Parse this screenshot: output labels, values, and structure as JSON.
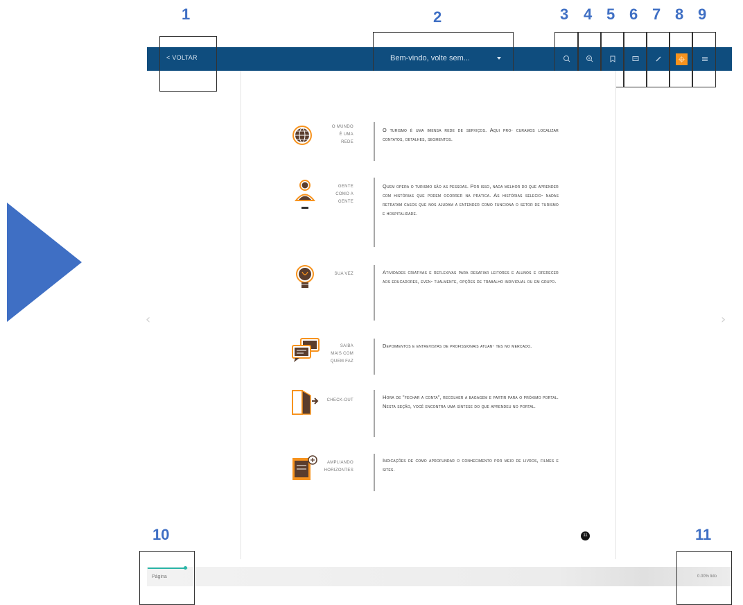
{
  "callouts": [
    "1",
    "2",
    "3",
    "4",
    "5",
    "6",
    "7",
    "8",
    "9",
    "10",
    "11"
  ],
  "toolbar": {
    "back_label": "< VOLTAR",
    "chapter_title": "Bem-vindo, volte sem...",
    "icons": [
      "search-icon",
      "zoom-in-icon",
      "bookmark-icon",
      "comment-icon",
      "pencil-icon",
      "highlight-icon",
      "menu-icon"
    ],
    "accent": "#f7931e",
    "bar_color": "#0f4d7e"
  },
  "content": {
    "rows": [
      {
        "icon": "globe-icon",
        "label": [
          "O MUNDO",
          "É UMA",
          "REDE"
        ],
        "text": "O turismo é uma imensa rede de serviços. Aqui pro- curamos localizar contatos, detalhes, segmentos."
      },
      {
        "icon": "person-icon",
        "label": [
          "GENTE",
          "COMO A",
          "GENTE"
        ],
        "text": "Quem opera o turismo são as pessoas. Por isso, nada melhor do que aprender com histórias que podem ocorrer na prática. As histórias selecio- nadas retratam casos que nos ajudam a entender como funciona o setor de turismo e hospitalidade."
      },
      {
        "icon": "lightbulb-icon",
        "label": [
          "SUA VEZ"
        ],
        "text": "Atividades criativas e reflexivas para desafiar leitores e alunos e oferecer aos educadores, even- tualmente, opções de trabalho individual ou em grupo."
      },
      {
        "icon": "speech-bubbles-icon",
        "label": [
          "SAIBA",
          "MAIS COM",
          "QUEM FAZ"
        ],
        "text": "Depoimentos e entrevistas de profissionais atuan- tes no mercado."
      },
      {
        "icon": "door-exit-icon",
        "label": [
          "CHECK-OUT"
        ],
        "text": "Hora de \"fechar a conta\", recolher a bagagem e partir para o próximo portal. Nesta seção, você encontra uma síntese do que aprendeu no portal."
      },
      {
        "icon": "book-add-icon",
        "label": [
          "AMPLIANDO",
          "HORIZONTES"
        ],
        "text": "Indicações de como aprofundar o conhecimento por meio de livros, filmes e sites."
      }
    ],
    "page_number": "11"
  },
  "footer": {
    "page_label": "Página",
    "zoom_label": "0.00% lido",
    "progress_fraction": 0.95
  },
  "colors": {
    "callout_blue": "#3f6fc4",
    "play_arrow": "#3f6fc4",
    "icon_orange": "#f7931e"
  }
}
